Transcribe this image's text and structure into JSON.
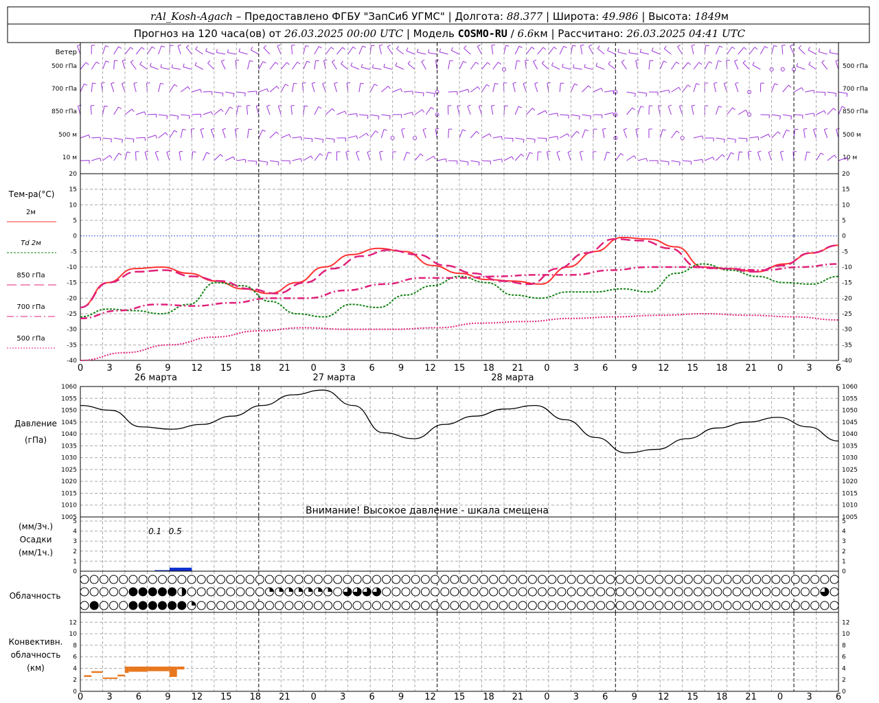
{
  "header": {
    "station": "rAl_Kosh-Agach",
    "provided_by": "Предоставлено ФГБУ \"ЗапСиб УГМС\"",
    "lon_label": "Долгота:",
    "lon_value": "88.377",
    "lat_label": "Широта:",
    "lat_value": "49.986",
    "alt_label": "Высота:",
    "alt_value": "1849",
    "alt_unit": "м",
    "forecast_prefix": "Прогноз на 120 часа(ов) от",
    "forecast_start": "26.03.2025 00:00 UTC",
    "model_label": "Модель",
    "model_name": "COSMO-RU",
    "model_res": "6.6",
    "model_res_unit": "км",
    "calc_label": "Рассчитано:",
    "calc_time": "26.03.2025 04:41 UTC"
  },
  "wind": {
    "title": "Ветер",
    "levels": [
      "500 гПа",
      "700 гПа",
      "850 гПа",
      "500 м",
      "10   м"
    ],
    "color": "#9b30d9"
  },
  "temperature": {
    "title": "Тем-ра(°C)",
    "legend": [
      {
        "label": "2м",
        "color": "#ff3030",
        "dash": ""
      },
      {
        "label": "Td  2м",
        "color": "#108010",
        "dash": "3 2"
      },
      {
        "label": "850 гПа",
        "color": "#e0207a",
        "dash": "14 6"
      },
      {
        "label": "700 гПа",
        "color": "#e0207a",
        "dash": "10 4 2 4"
      },
      {
        "label": "500 гПа",
        "color": "#e0207a",
        "dash": "2 2"
      }
    ],
    "yticks": [
      "20",
      "15",
      "10",
      "5",
      "0",
      "-5",
      "-10",
      "-15",
      "-20",
      "-25",
      "-30",
      "-35",
      "-40"
    ]
  },
  "xaxis": {
    "hour_labels": [
      "0",
      "3",
      "6",
      "9",
      "12",
      "15",
      "18",
      "21",
      "0",
      "3",
      "6",
      "9",
      "12",
      "15",
      "18",
      "21",
      "0",
      "3",
      "6",
      "9",
      "12",
      "15",
      "18",
      "21",
      "0",
      "3",
      "6"
    ],
    "day_labels": [
      "26 марта",
      "27 марта",
      "28 марта"
    ]
  },
  "pressure": {
    "title": "Давление",
    "unit": "(гПа)",
    "yticks": [
      "1060",
      "1055",
      "1050",
      "1045",
      "1040",
      "1035",
      "1030",
      "1025",
      "1020",
      "1015",
      "1010",
      "1005"
    ],
    "warning": "Внимание! Высокое давление - шкала смещена"
  },
  "precip": {
    "unit3": "(мм/3ч.)",
    "title": "Осадки",
    "unit1": "(мм/1ч.)",
    "yticks": [
      "5",
      "4",
      "3",
      "2",
      "1",
      "0"
    ],
    "annot": [
      "0.1",
      "0.5"
    ],
    "color": "#1030d0"
  },
  "clouds": {
    "title": "Облачность"
  },
  "convective": {
    "title1": "Конвективн.",
    "title2": "облачность",
    "unit": "(км)",
    "yticks": [
      "12",
      "10",
      "8",
      "6",
      "4",
      "2",
      "0"
    ],
    "color": "#e87820"
  },
  "chart_data": {
    "type": "line",
    "x_hours": [
      0,
      6,
      9,
      12,
      15,
      18,
      21,
      24,
      30,
      33,
      36,
      39,
      42,
      45,
      48,
      51,
      54,
      57,
      60,
      63,
      66,
      69,
      72,
      78,
      81,
      84,
      87,
      90,
      93,
      96,
      99,
      102
    ],
    "series": [
      {
        "name": "2м",
        "values": [
          -23,
          -15,
          -10.5,
          -10,
          -12,
          -14.5,
          -17,
          -18.5,
          -15,
          -10,
          -6,
          -4,
          -5,
          -9.5,
          -12,
          -14,
          -14.5,
          -15.5,
          -10,
          -5,
          -0.5,
          -1,
          -3.5,
          -10,
          -10.5,
          -11.5,
          -9,
          -5.5,
          -3
        ]
      },
      {
        "name": "Td  2м",
        "values": [
          -26,
          -23.5,
          -24,
          -25,
          -22,
          -15,
          -16,
          -21,
          -25,
          -26,
          -22,
          -23,
          -19,
          -16,
          -13,
          -15,
          -19,
          -20,
          -18,
          -18,
          -17,
          -18,
          -12,
          -9,
          -11,
          -13,
          -15,
          -15.5,
          -13
        ]
      },
      {
        "name": "850 гПа",
        "values": [
          -23,
          -15,
          -11.5,
          -11,
          -13,
          -14.5,
          -17,
          -18.5,
          -15,
          -10.5,
          -6.5,
          -4.5,
          -6,
          -9.5,
          -12,
          -14.5,
          -15.5,
          -10.5,
          -5.5,
          -1,
          -1.5,
          -4,
          -10,
          -10.5,
          -11.5,
          -9.5,
          -5.5,
          -3
        ]
      },
      {
        "name": "700 гПа",
        "values": [
          -26.5,
          -24,
          -22,
          -22.5,
          -21.5,
          -20,
          -20,
          -17.5,
          -15.5,
          -13.5,
          -13.5,
          -13,
          -12.5,
          -12.5,
          -11,
          -10,
          -10,
          -10.5,
          -11,
          -10,
          -9
        ]
      },
      {
        "name": "500 гПа",
        "values": [
          -40,
          -37.5,
          -35,
          -32.5,
          -30.5,
          -29.5,
          -30,
          -30,
          -29.5,
          -28,
          -27.5,
          -26.5,
          -26,
          -25.5,
          -25,
          -25.5,
          -26,
          -27
        ]
      }
    ],
    "pressure_values": [
      1052,
      1050,
      1043,
      1042,
      1044,
      1047.5,
      1052,
      1056.5,
      1058.5,
      1052,
      1040.5,
      1038,
      1044,
      1047.5,
      1050.5,
      1052,
      1046,
      1038.5,
      1032,
      1033.5,
      1038,
      1042.5,
      1045,
      1047,
      1043,
      1037
    ],
    "precip_mm": [
      0.1,
      0.5
    ],
    "ylim_temp": [
      -40,
      20
    ],
    "ylim_pressure": [
      1005,
      1060
    ],
    "ylim_precip": [
      0,
      5
    ],
    "ylim_convective": [
      0,
      13
    ]
  }
}
